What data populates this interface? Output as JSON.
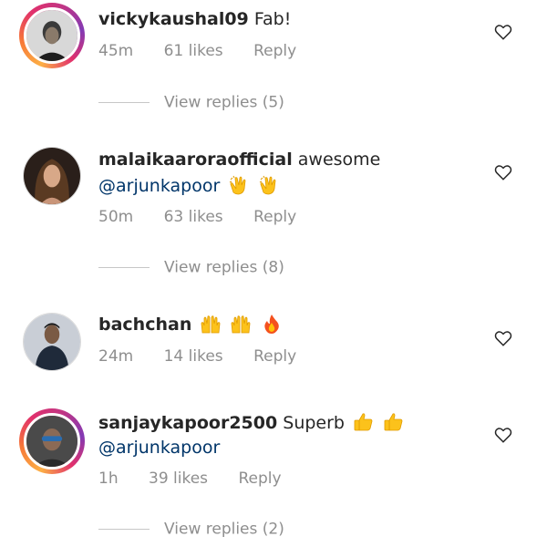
{
  "comments": [
    {
      "username": "vickykaushal09",
      "text": "Fab!",
      "mention": "",
      "emojis": [],
      "time": "45m",
      "likes": "61 likes",
      "reply_label": "Reply",
      "view_replies": "View replies (5)",
      "has_story": true
    },
    {
      "username": "malaikaaroraofficial",
      "text": "awesome",
      "mention": "@arjunkapoor",
      "emojis": [
        "clapping-hands-emoji",
        "clapping-hands-emoji"
      ],
      "time": "50m",
      "likes": "63 likes",
      "reply_label": "Reply",
      "view_replies": "View replies (8)",
      "has_story": false
    },
    {
      "username": "bachchan",
      "text": "",
      "mention": "",
      "emojis": [
        "raising-hands-emoji",
        "raising-hands-emoji",
        "fire-emoji"
      ],
      "time": "24m",
      "likes": "14 likes",
      "reply_label": "Reply",
      "view_replies": "",
      "has_story": false
    },
    {
      "username": "sanjaykapoor2500",
      "text": "Superb",
      "mention": "@arjunkapoor",
      "emojis": [
        "thumbs-up-emoji",
        "thumbs-up-emoji"
      ],
      "time": "1h",
      "likes": "39 likes",
      "reply_label": "Reply",
      "view_replies": "View replies (2)",
      "has_story": true
    }
  ],
  "colors": {
    "text": "#262626",
    "muted": "#8e8e8e",
    "mention": "#003569",
    "story_ring": "#e1306c"
  }
}
